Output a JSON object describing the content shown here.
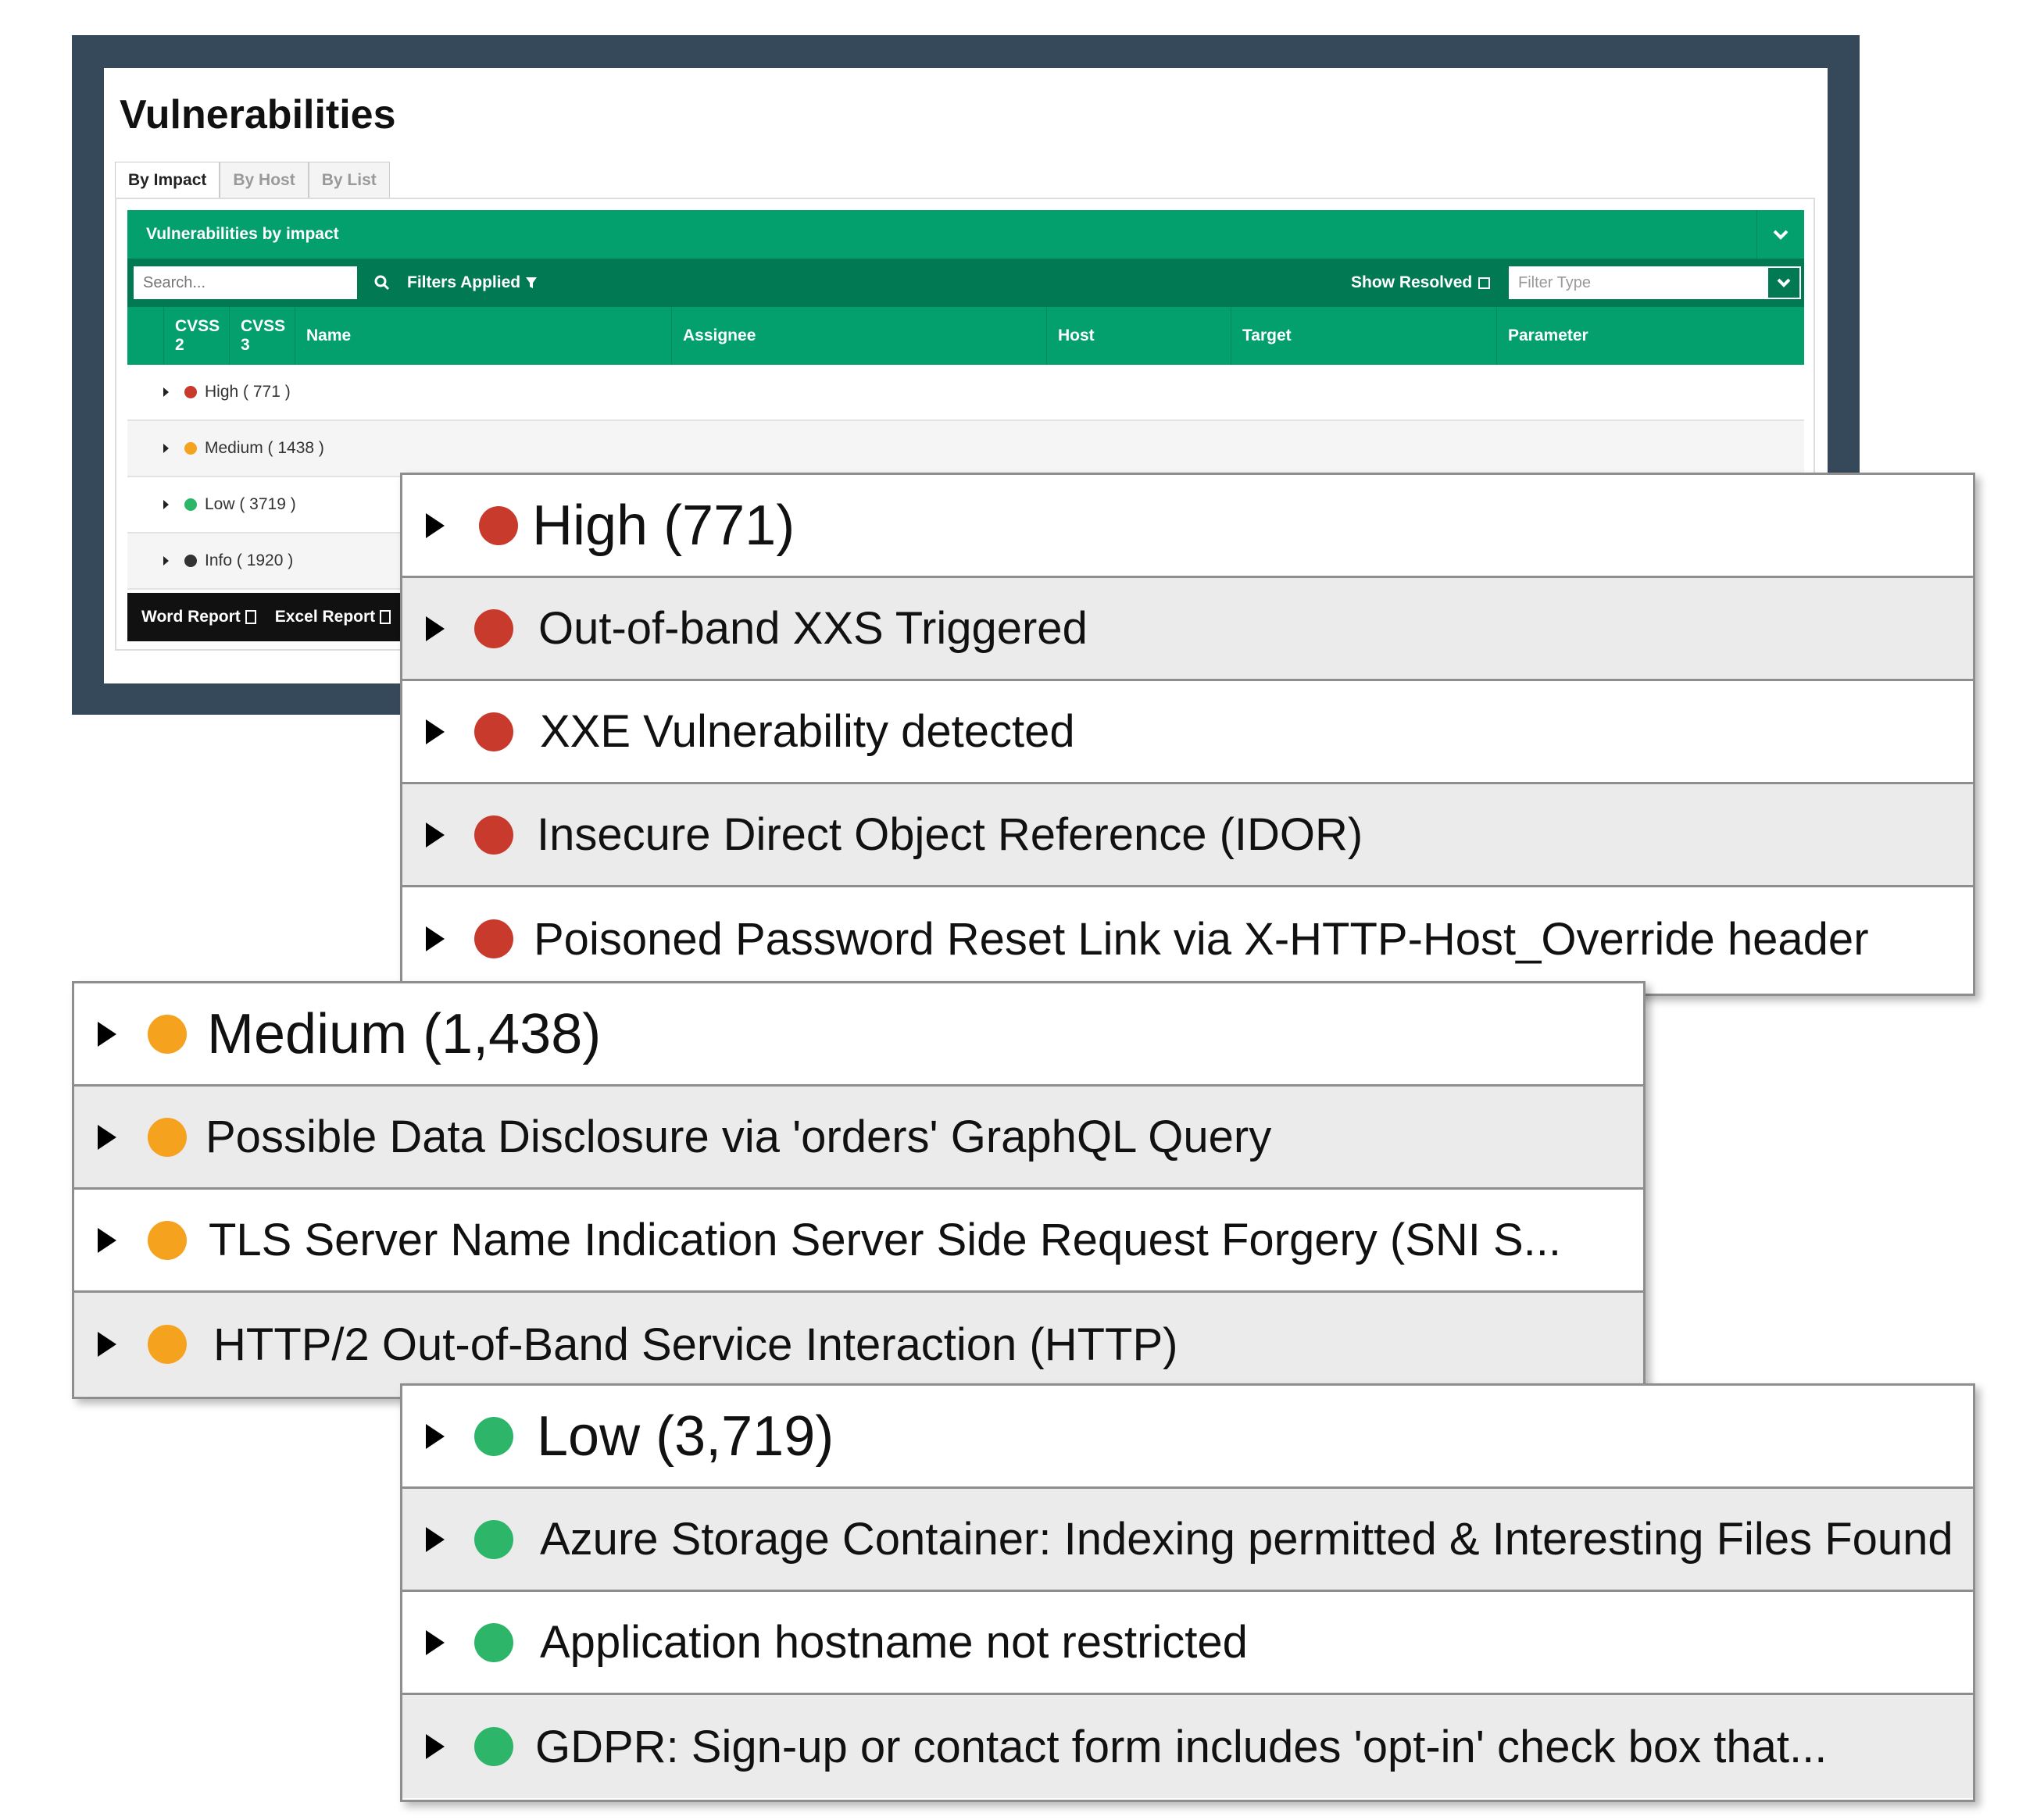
{
  "page": {
    "title": "Vulnerabilities",
    "tabs": [
      {
        "label": "By Impact",
        "active": true
      },
      {
        "label": "By Host",
        "active": false
      },
      {
        "label": "By List",
        "active": false
      }
    ]
  },
  "panel": {
    "header": "Vulnerabilities by impact",
    "search_placeholder": "Search...",
    "filters_label": "Filters Applied",
    "show_resolved_label": "Show Resolved",
    "filter_type_placeholder": "Filter Type",
    "columns": [
      "CVSS 2",
      "CVSS 3",
      "Name",
      "Assignee",
      "Host",
      "Target",
      "Parameter"
    ],
    "groups": [
      {
        "label": "High ( 771 )",
        "color": "#c83a2c"
      },
      {
        "label": "Medium ( 1438 )",
        "color": "#f5a21f"
      },
      {
        "label": "Low ( 3719 )",
        "color": "#2db56a"
      },
      {
        "label": "Info ( 1920 )",
        "color": "#333333"
      }
    ],
    "reports": {
      "word": "Word Report",
      "excel": "Excel Report"
    }
  },
  "callouts": {
    "high": {
      "color": "#c83a2c",
      "header": "High (771)",
      "items": [
        "Out-of-band XXS Triggered",
        "XXE Vulnerability detected",
        "Insecure Direct Object Reference (IDOR)",
        "Poisoned Password Reset Link via X-HTTP-Host_Override header"
      ]
    },
    "medium": {
      "color": "#f5a21f",
      "header": "Medium (1,438)",
      "items": [
        "Possible Data Disclosure via 'orders' GraphQL Query",
        "TLS Server Name Indication Server Side Request Forgery (SNI S...",
        "HTTP/2 Out-of-Band Service Interaction (HTTP)"
      ]
    },
    "low": {
      "color": "#2db56a",
      "header": "Low (3,719)",
      "items": [
        "Azure Storage Container: Indexing permitted & Interesting Files Found",
        "Application hostname not restricted",
        "GDPR: Sign-up or contact form includes 'opt-in' check box that..."
      ]
    }
  }
}
